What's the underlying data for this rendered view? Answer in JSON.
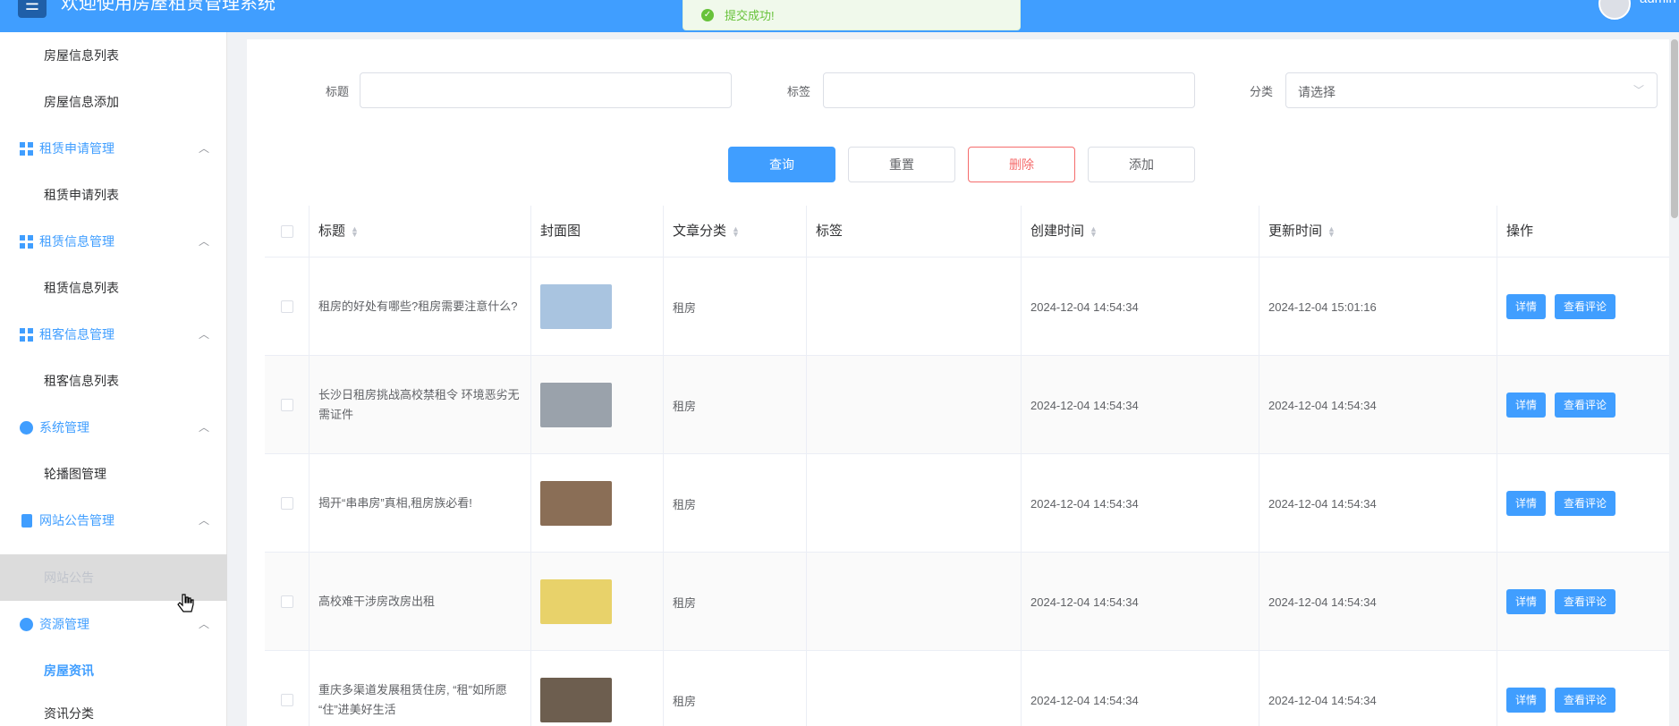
{
  "header": {
    "menu_icon": "☰",
    "title": "欢迎使用房屋租赁管理系统",
    "user": "admin"
  },
  "toast": {
    "text": "提交成功!"
  },
  "sidebar": {
    "items": [
      {
        "type": "sub",
        "label": "房屋信息列表"
      },
      {
        "type": "sub",
        "label": "房屋信息添加"
      },
      {
        "type": "group",
        "label": "租赁申请管理",
        "icon": "grid-icon"
      },
      {
        "type": "sub",
        "label": "租赁申请列表"
      },
      {
        "type": "group",
        "label": "租赁信息管理",
        "icon": "grid-icon"
      },
      {
        "type": "sub",
        "label": "租赁信息列表"
      },
      {
        "type": "group",
        "label": "租客信息管理",
        "icon": "grid-icon"
      },
      {
        "type": "sub",
        "label": "租客信息列表"
      },
      {
        "type": "group",
        "label": "系统管理",
        "icon": "gear-icon"
      },
      {
        "type": "sub",
        "label": "轮播图管理"
      },
      {
        "type": "group",
        "label": "网站公告管理",
        "icon": "document-icon"
      },
      {
        "type": "sub",
        "label": "网站公告",
        "state": "hover"
      },
      {
        "type": "group",
        "label": "资源管理",
        "icon": "resource-icon"
      },
      {
        "type": "sub",
        "label": "房屋资讯",
        "state": "active"
      },
      {
        "type": "sub",
        "label": "资讯分类"
      }
    ]
  },
  "search": {
    "title_label": "标题",
    "tag_label": "标签",
    "category_label": "分类",
    "category_placeholder": "请选择",
    "buttons": {
      "query": "查询",
      "reset": "重置",
      "delete": "删除",
      "add": "添加"
    }
  },
  "table": {
    "headers": {
      "title": "标题",
      "cover": "封面图",
      "category": "文章分类",
      "tags": "标签",
      "created": "创建时间",
      "updated": "更新时间",
      "actions": "操作"
    },
    "detail_label": "详情",
    "comments_label": "查看评论",
    "rows": [
      {
        "title": "租房的好处有哪些?租房需要注意什么?",
        "category": "租房",
        "tags": "",
        "created": "2024-12-04 14:54:34",
        "updated": "2024-12-04 15:01:16",
        "cover_color": "#a9c4e0"
      },
      {
        "title": "长沙日租房挑战高校禁租令 环境恶劣无需证件",
        "category": "租房",
        "tags": "",
        "created": "2024-12-04 14:54:34",
        "updated": "2024-12-04 14:54:34",
        "cover_color": "#9aa2ab"
      },
      {
        "title": "揭开“串串房”真相,租房族必看!",
        "category": "租房",
        "tags": "",
        "created": "2024-12-04 14:54:34",
        "updated": "2024-12-04 14:54:34",
        "cover_color": "#8a6e56"
      },
      {
        "title": "高校难干涉房改房出租",
        "category": "租房",
        "tags": "",
        "created": "2024-12-04 14:54:34",
        "updated": "2024-12-04 14:54:34",
        "cover_color": "#e8d26a"
      },
      {
        "title": "重庆多渠道发展租赁住房, “租”如所愿 “住”进美好生活",
        "category": "租房",
        "tags": "",
        "created": "2024-12-04 14:54:34",
        "updated": "2024-12-04 14:54:34",
        "cover_color": "#6d5e4f"
      }
    ]
  }
}
